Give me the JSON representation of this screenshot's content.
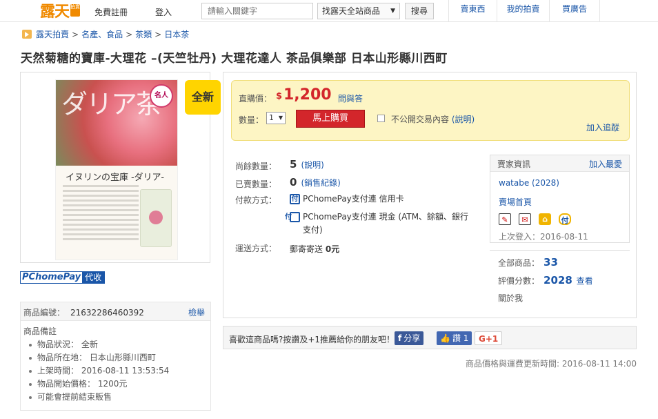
{
  "topbar": {
    "logo": "露天",
    "logo_badge": "拍賣",
    "register": "免費註冊",
    "login": "登入",
    "search_placeholder": "請輸入關鍵字",
    "search_scope": "找露天全站商品",
    "search_button": "搜尋",
    "tabs": [
      "賣東西",
      "我的拍賣",
      "買廣告"
    ]
  },
  "breadcrumb": [
    "露天拍賣",
    "名產、食品",
    "茶類",
    "日本茶"
  ],
  "product": {
    "title": "天然菊糖的寶庫-大理花 –(天竺牡丹) 大理花達人 茶品俱樂部 日本山形縣川西町",
    "badge": "全新",
    "image_text": {
      "kana": "ダリア茶",
      "medal": "名人",
      "subtitle": "イヌリンの宝庫 -ダリア-"
    },
    "pchome_logo": "PChomePay",
    "pchome_badge": "代收"
  },
  "info": {
    "id_label": "商品編號：",
    "id_value": "21632286460392",
    "report": "檢舉",
    "notes_title": "商品備註",
    "notes": [
      "物品狀況： 全新",
      "物品所在地： 日本山形縣川西町",
      "上架時間： 2016-08-11 13:53:54",
      "物品開始價格： 1200元",
      "可能會提前結束販售"
    ]
  },
  "buy": {
    "price_label": "直購價：",
    "currency": "$",
    "price": "1,200",
    "ask": "問與答",
    "qty_label": "數量：",
    "qty_value": "1",
    "buy_button": "馬上購買",
    "private_label": "不公開交易內容",
    "private_help": "(說明)",
    "track": "加入追蹤"
  },
  "details": {
    "remaining_label": "尚餘數量：",
    "remaining": "5",
    "remaining_help": "(說明)",
    "sold_label": "已賣數量：",
    "sold": "0",
    "sold_help": "(銷售紀錄)",
    "payment_label": "付款方式：",
    "payment1": "PChomePay支付連 信用卡",
    "payment2": "PChomePay支付連 現金 (ATM、餘額、銀行支付)",
    "shipping_label": "運送方式：",
    "shipping": "郵寄寄送",
    "shipping_cost": "0元"
  },
  "seller": {
    "header": "賣家資訊",
    "favorite": "加入最愛",
    "name": "watabe (2028)",
    "shop": "賣場首頁",
    "last_login": "上次登入：2016-08-11",
    "total_label": "全部商品：",
    "total": "33",
    "rating_label": "評價分數：",
    "rating": "2028",
    "rating_view": "查看",
    "about": "關於我"
  },
  "share": {
    "text": "喜歡這商品嗎?按讚及+1推薦給你的朋友吧！",
    "fb_share": "分享",
    "like": "讚 1",
    "gplus": "G+1"
  },
  "update_time": "商品價格與運費更新時間: 2016-08-11 14:00",
  "colors": {
    "brand_orange": "#f08a00",
    "link_blue": "#1a56a8",
    "price_red": "#d3262b",
    "buy_box": "#fdf5c4",
    "badge_yellow": "#ffd400"
  }
}
